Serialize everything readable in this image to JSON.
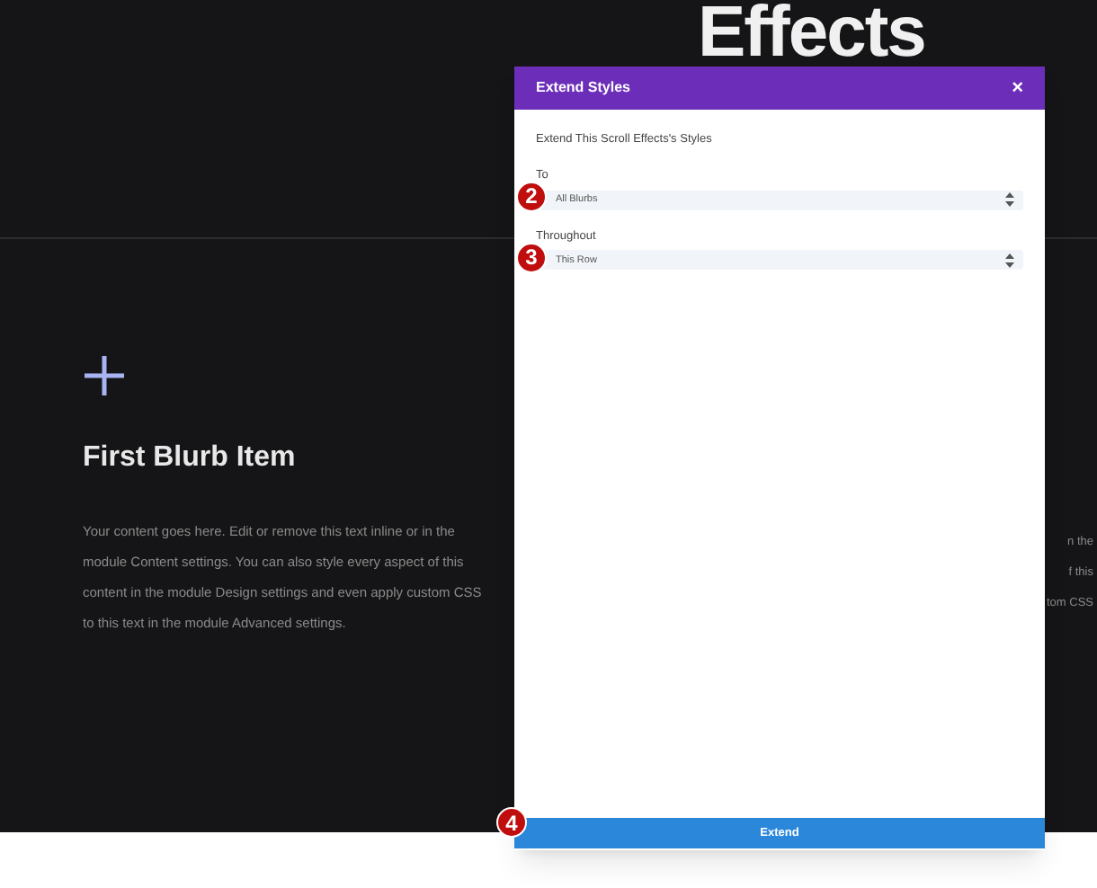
{
  "hero_heading": "Effects",
  "blurb": {
    "title": "First Blurb Item",
    "body": "Your content goes here. Edit or remove this text inline or in the module Content settings. You can also style every aspect of this content in the module Design settings and even apply custom CSS to this text in the module Advanced settings."
  },
  "right_column_lines": [
    "n the",
    "f this",
    "tom CSS"
  ],
  "modal": {
    "title": "Extend Styles",
    "close": "×",
    "intro": "Extend This Scroll Effects's Styles",
    "fields": [
      {
        "label": "To",
        "value": "All Blurbs",
        "step": "2"
      },
      {
        "label": "Throughout",
        "value": "This Row",
        "step": "3"
      }
    ],
    "button": {
      "label": "Extend",
      "step": "4"
    }
  }
}
